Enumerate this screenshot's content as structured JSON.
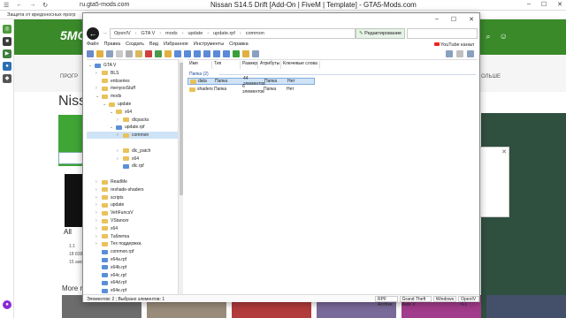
{
  "browser": {
    "url": "ru.gta5-mods.com",
    "page_title": "Nissan S14.5 Drift [Add-On | FiveM | Template] - GTA5-Mods.com",
    "security_notice": "Защита от вредоносных прогр"
  },
  "site": {
    "logo": "5MODS",
    "nav_left": "ПРОГР",
    "nav_right": "ОЛЬШЕ",
    "title_fragment": "Niss",
    "all_label": "All",
    "row1": "1.1",
    "row2": "18 838",
    "row3": "15 акку",
    "more_label": "More n",
    "colors": {
      "header": "#3a8a2a",
      "green_button": "#3fa535"
    }
  },
  "explorer": {
    "address": [
      "OpenIV",
      "GTA V",
      "mods",
      "update",
      "update.rpf",
      "common"
    ],
    "edit_button": "Редактирование",
    "menu": [
      "Файл",
      "Правка",
      "Создать",
      "Вид",
      "Избранное",
      "Инструменты",
      "Справка"
    ],
    "youtube_label": "YouTube канал",
    "tree": [
      {
        "label": "GTA V",
        "depth": 0,
        "arrow": "v",
        "icon": "blue"
      },
      {
        "label": "BLS",
        "depth": 1,
        "arrow": ">",
        "icon": "yellow"
      },
      {
        "label": "enbseries",
        "depth": 1,
        "arrow": "",
        "icon": "yellow"
      },
      {
        "label": "menyooStuff",
        "depth": 1,
        "arrow": ">",
        "icon": "yellow"
      },
      {
        "label": "mods",
        "depth": 1,
        "arrow": "v",
        "icon": "yellow"
      },
      {
        "label": "update",
        "depth": 2,
        "arrow": "v",
        "icon": "yellow"
      },
      {
        "label": "x64",
        "depth": 3,
        "arrow": "v",
        "icon": "yellow"
      },
      {
        "label": "dlcpacks",
        "depth": 4,
        "arrow": ">",
        "icon": "yellow"
      },
      {
        "label": "update.rpf",
        "depth": 3,
        "arrow": "v",
        "icon": "blue"
      },
      {
        "label": "common",
        "depth": 4,
        "arrow": ">",
        "icon": "yellow",
        "selected": true
      },
      {
        "label": "",
        "depth": 4,
        "arrow": "",
        "icon": "none"
      },
      {
        "label": "dlc_patch",
        "depth": 4,
        "arrow": ">",
        "icon": "yellow"
      },
      {
        "label": "x64",
        "depth": 4,
        "arrow": ">",
        "icon": "yellow"
      },
      {
        "label": "dlc.rpf",
        "depth": 4,
        "arrow": "",
        "icon": "blue"
      },
      {
        "label": "",
        "depth": 1,
        "arrow": "",
        "icon": "none"
      },
      {
        "label": "ReadMe",
        "depth": 1,
        "arrow": ">",
        "icon": "yellow"
      },
      {
        "label": "reshade-shaders",
        "depth": 1,
        "arrow": ">",
        "icon": "yellow"
      },
      {
        "label": "scripts",
        "depth": 1,
        "arrow": ">",
        "icon": "yellow"
      },
      {
        "label": "update",
        "depth": 1,
        "arrow": ">",
        "icon": "yellow"
      },
      {
        "label": "VehFuncsV",
        "depth": 1,
        "arrow": ">",
        "icon": "yellow"
      },
      {
        "label": "VStancer",
        "depth": 1,
        "arrow": ">",
        "icon": "yellow"
      },
      {
        "label": "x64",
        "depth": 1,
        "arrow": ">",
        "icon": "yellow"
      },
      {
        "label": "Таблетка",
        "depth": 1,
        "arrow": ">",
        "icon": "yellow"
      },
      {
        "label": "Тех поддержка",
        "depth": 1,
        "arrow": ">",
        "icon": "yellow"
      },
      {
        "label": "common.rpf",
        "depth": 1,
        "arrow": "",
        "icon": "blue"
      },
      {
        "label": "x64a.rpf",
        "depth": 1,
        "arrow": "",
        "icon": "blue"
      },
      {
        "label": "x64b.rpf",
        "depth": 1,
        "arrow": "",
        "icon": "blue"
      },
      {
        "label": "x64c.rpf",
        "depth": 1,
        "arrow": "",
        "icon": "blue"
      },
      {
        "label": "x64d.rpf",
        "depth": 1,
        "arrow": "",
        "icon": "blue"
      },
      {
        "label": "x64e.rpf",
        "depth": 1,
        "arrow": "",
        "icon": "blue"
      }
    ],
    "columns": [
      "Имя",
      "Тип",
      "Размер",
      "Атрибуты",
      "Ключевые слова"
    ],
    "group_label": "Папка (2)",
    "files": [
      {
        "name": "data",
        "type": "Папка",
        "size": "44 элементов",
        "attr": "Папка",
        "keys": "Нет",
        "selected": true
      },
      {
        "name": "shaders",
        "type": "Папка",
        "size": "6 элементов",
        "attr": "Папка",
        "keys": "Нет",
        "selected": false
      }
    ],
    "status_left": "Элементов: 2 ; Выбрано элементов: 1",
    "status_tags": [
      "RPF Archive",
      "Grand Theft Auto V",
      "Windows",
      "OpenIV 4.1"
    ]
  }
}
